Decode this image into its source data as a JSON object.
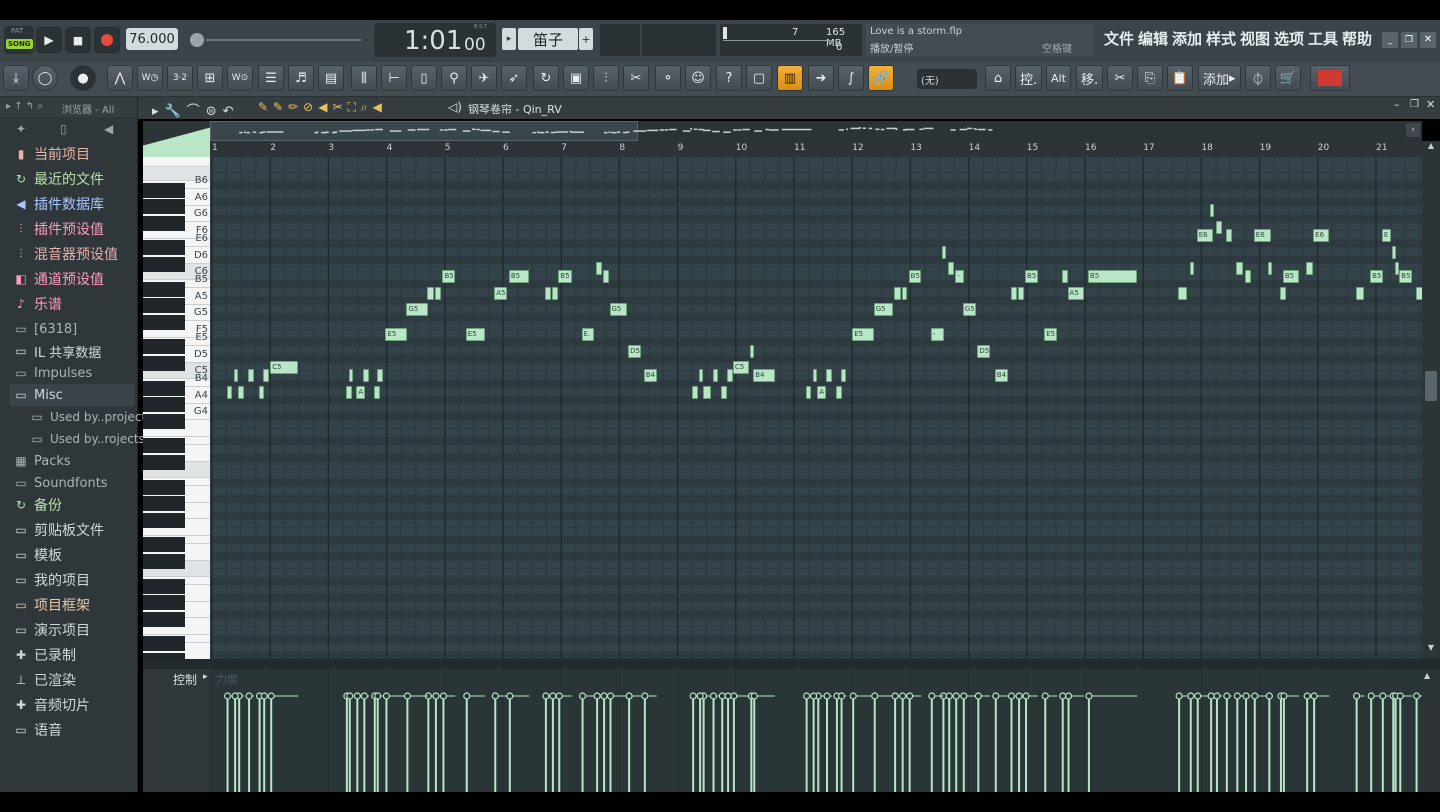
{
  "transport": {
    "pat_label": "PAT",
    "song_label": "SONG",
    "tempo": "76.000",
    "time_display": "1:01",
    "time_sub": "00",
    "bst": "B:S:T",
    "instrument": "笛子",
    "cpu_value": "7",
    "memory": "165 MB",
    "poly": "0"
  },
  "hint": {
    "filename": "Love is a storm.flp",
    "action": "播放/暂停",
    "key": "空格键"
  },
  "menu": [
    "文件",
    "编辑",
    "添加",
    "样式",
    "视图",
    "选项",
    "工具",
    "帮助"
  ],
  "toolbar": {
    "control_label": "控.",
    "alt_label": "Alt",
    "move_label": "移.",
    "add_label": "添加",
    "snap_value": "(无)"
  },
  "browser": {
    "title": "浏览器 - All",
    "items": [
      {
        "label": "当前项目",
        "icon": "project-icon",
        "color": "#e8b4a8"
      },
      {
        "label": "最近的文件",
        "icon": "recent-icon",
        "color": "#b8e0a8"
      },
      {
        "label": "插件数据库",
        "icon": "plugin-db-icon",
        "color": "#a8c8ff"
      },
      {
        "label": "插件预设值",
        "icon": "plugin-preset-icon",
        "color": "#ff9ac0"
      },
      {
        "label": "混音器预设值",
        "icon": "mixer-preset-icon",
        "color": "#e8b0b0"
      },
      {
        "label": "通道预设值",
        "icon": "channel-preset-icon",
        "color": "#ff9ac0"
      },
      {
        "label": "乐谱",
        "icon": "score-icon",
        "color": "#ff9ac0"
      },
      {
        "label": "[6318]",
        "icon": "folder-icon",
        "color": "#aab4b8"
      },
      {
        "label": "IL 共享数据",
        "icon": "folder-icon",
        "color": "#d0d8dc"
      },
      {
        "label": "Impulses",
        "icon": "folder-icon",
        "color": "#aab4b8"
      },
      {
        "label": "Misc",
        "icon": "folder-icon",
        "color": "#d0d8dc"
      },
      {
        "label": "Used by..projects",
        "icon": "folder-icon",
        "color": "#aab4b8"
      },
      {
        "label": "Used by..rojects",
        "icon": "folder-icon",
        "color": "#aab4b8"
      },
      {
        "label": "Packs",
        "icon": "packs-icon",
        "color": "#aab4b8"
      },
      {
        "label": "Soundfonts",
        "icon": "folder-icon",
        "color": "#aab4b8"
      },
      {
        "label": "备份",
        "icon": "backup-icon",
        "color": "#b8e0a8"
      },
      {
        "label": "剪贴板文件",
        "icon": "folder-icon",
        "color": "#d0d8dc"
      },
      {
        "label": "模板",
        "icon": "folder-icon",
        "color": "#d0d8dc"
      },
      {
        "label": "我的项目",
        "icon": "folder-icon",
        "color": "#d0d8dc"
      },
      {
        "label": "项目框架",
        "icon": "folder-icon",
        "color": "#e8c8a8"
      },
      {
        "label": "演示项目",
        "icon": "folder-icon",
        "color": "#d0d8dc"
      },
      {
        "label": "已录制",
        "icon": "recorded-icon",
        "color": "#d0d8dc"
      },
      {
        "label": "已渲染",
        "icon": "rendered-icon",
        "color": "#d0d8dc"
      },
      {
        "label": "音频切片",
        "icon": "slice-icon",
        "color": "#d0d8dc"
      },
      {
        "label": "语音",
        "icon": "voice-icon",
        "color": "#d0d8dc"
      }
    ]
  },
  "pianoroll": {
    "title": "钢琴卷帘 - Qin_RV",
    "control_label": "控制",
    "lane_label": "力度",
    "bars": [
      "1",
      "2",
      "3",
      "4",
      "5",
      "6",
      "7",
      "8",
      "9",
      "10",
      "11",
      "12",
      "13",
      "14",
      "15",
      "16",
      "17",
      "18",
      "19",
      "20",
      "21"
    ],
    "key_labels": [
      "B6",
      "A6",
      "G6",
      "F6",
      "E6",
      "D6",
      "C6",
      "B5",
      "A5",
      "G5",
      "F5",
      "E5",
      "D5",
      "C5",
      "B4",
      "A4",
      "G4"
    ],
    "notes": [
      {
        "pitch": "A4",
        "bar": 1.25,
        "len": 0.1,
        "label": ""
      },
      {
        "pitch": "A4",
        "bar": 1.45,
        "len": 0.1,
        "label": ""
      },
      {
        "pitch": "A4",
        "bar": 1.8,
        "len": 0.1,
        "label": ""
      },
      {
        "pitch": "B4",
        "bar": 1.38,
        "len": 0.06,
        "label": ""
      },
      {
        "pitch": "B4",
        "bar": 1.62,
        "len": 0.1,
        "label": ""
      },
      {
        "pitch": "B4",
        "bar": 1.88,
        "len": 0.1,
        "label": ""
      },
      {
        "pitch": "C5",
        "bar": 2.0,
        "len": 0.48,
        "label": "C5"
      },
      {
        "pitch": "A4",
        "bar": 3.3,
        "len": 0.1,
        "label": ""
      },
      {
        "pitch": "A4",
        "bar": 3.48,
        "len": 0.15,
        "label": "A"
      },
      {
        "pitch": "A4",
        "bar": 3.78,
        "len": 0.1,
        "label": ""
      },
      {
        "pitch": "B4",
        "bar": 3.35,
        "len": 0.06,
        "label": ""
      },
      {
        "pitch": "B4",
        "bar": 3.6,
        "len": 0.1,
        "label": ""
      },
      {
        "pitch": "B4",
        "bar": 3.83,
        "len": 0.1,
        "label": ""
      },
      {
        "pitch": "E5",
        "bar": 3.98,
        "len": 0.37,
        "label": "E5"
      },
      {
        "pitch": "A5",
        "bar": 4.7,
        "len": 0.12,
        "label": ""
      },
      {
        "pitch": "A5",
        "bar": 4.83,
        "len": 0.1,
        "label": ""
      },
      {
        "pitch": "B5",
        "bar": 4.96,
        "len": 0.22,
        "label": "B5"
      },
      {
        "pitch": "G5",
        "bar": 4.34,
        "len": 0.37,
        "label": "G5"
      },
      {
        "pitch": "E5",
        "bar": 5.36,
        "len": 0.33,
        "label": "E5"
      },
      {
        "pitch": "A5",
        "bar": 5.85,
        "len": 0.22,
        "label": "A5"
      },
      {
        "pitch": "B5",
        "bar": 6.1,
        "len": 0.35,
        "label": "B5"
      },
      {
        "pitch": "A5",
        "bar": 6.72,
        "len": 0.1,
        "label": ""
      },
      {
        "pitch": "A5",
        "bar": 6.84,
        "len": 0.1,
        "label": ""
      },
      {
        "pitch": "B5",
        "bar": 6.95,
        "len": 0.23,
        "label": "B5"
      },
      {
        "pitch": "E5",
        "bar": 7.35,
        "len": 0.22,
        "label": "E."
      },
      {
        "pitch": "C6",
        "bar": 7.6,
        "len": 0.1,
        "label": ""
      },
      {
        "pitch": "B5",
        "bar": 7.72,
        "len": 0.1,
        "label": ""
      },
      {
        "pitch": "G5",
        "bar": 7.83,
        "len": 0.3,
        "label": "G5"
      },
      {
        "pitch": "D5",
        "bar": 8.15,
        "len": 0.22,
        "label": "D5"
      },
      {
        "pitch": "B4",
        "bar": 8.42,
        "len": 0.22,
        "label": "B4"
      },
      {
        "pitch": "A4",
        "bar": 9.25,
        "len": 0.1,
        "label": ""
      },
      {
        "pitch": "A4",
        "bar": 9.43,
        "len": 0.15,
        "label": ""
      },
      {
        "pitch": "A4",
        "bar": 9.75,
        "len": 0.1,
        "label": ""
      },
      {
        "pitch": "B4",
        "bar": 9.37,
        "len": 0.06,
        "label": ""
      },
      {
        "pitch": "B4",
        "bar": 9.6,
        "len": 0.1,
        "label": ""
      },
      {
        "pitch": "B4",
        "bar": 9.85,
        "len": 0.1,
        "label": ""
      },
      {
        "pitch": "C5",
        "bar": 9.95,
        "len": 0.28,
        "label": "C5"
      },
      {
        "pitch": "D5",
        "bar": 10.25,
        "len": 0.06,
        "label": ""
      },
      {
        "pitch": "B4",
        "bar": 10.3,
        "len": 0.37,
        "label": "B4"
      },
      {
        "pitch": "A4",
        "bar": 11.2,
        "len": 0.1,
        "label": ""
      },
      {
        "pitch": "A4",
        "bar": 11.4,
        "len": 0.15,
        "label": "A"
      },
      {
        "pitch": "A4",
        "bar": 11.72,
        "len": 0.1,
        "label": ""
      },
      {
        "pitch": "B4",
        "bar": 11.32,
        "len": 0.06,
        "label": ""
      },
      {
        "pitch": "B4",
        "bar": 11.55,
        "len": 0.1,
        "label": ""
      },
      {
        "pitch": "B4",
        "bar": 11.8,
        "len": 0.1,
        "label": ""
      },
      {
        "pitch": "E5",
        "bar": 12.0,
        "len": 0.37,
        "label": "E5"
      },
      {
        "pitch": "G5",
        "bar": 12.37,
        "len": 0.33,
        "label": "G5"
      },
      {
        "pitch": "A5",
        "bar": 12.72,
        "len": 0.12,
        "label": ""
      },
      {
        "pitch": "A5",
        "bar": 12.85,
        "len": 0.1,
        "label": ""
      },
      {
        "pitch": "B5",
        "bar": 12.97,
        "len": 0.22,
        "label": "B5"
      },
      {
        "pitch": "D6",
        "bar": 13.55,
        "len": 0.06,
        "label": ""
      },
      {
        "pitch": "C6",
        "bar": 13.65,
        "len": 0.1,
        "label": ""
      },
      {
        "pitch": "B5",
        "bar": 13.77,
        "len": 0.15,
        "label": "-"
      },
      {
        "pitch": "E5",
        "bar": 13.35,
        "len": 0.22,
        "label": "-"
      },
      {
        "pitch": "G5",
        "bar": 13.9,
        "len": 0.22,
        "label": "G5"
      },
      {
        "pitch": "D5",
        "bar": 14.15,
        "len": 0.22,
        "label": "D5"
      },
      {
        "pitch": "B4",
        "bar": 14.45,
        "len": 0.22,
        "label": "B4"
      },
      {
        "pitch": "A5",
        "bar": 14.72,
        "len": 0.12,
        "label": ""
      },
      {
        "pitch": "A5",
        "bar": 14.85,
        "len": 0.1,
        "label": ""
      },
      {
        "pitch": "B5",
        "bar": 14.97,
        "len": 0.22,
        "label": "B5"
      },
      {
        "pitch": "E5",
        "bar": 15.3,
        "len": 0.22,
        "label": "E5"
      },
      {
        "pitch": "B5",
        "bar": 15.6,
        "len": 0.1,
        "label": ""
      },
      {
        "pitch": "A5",
        "bar": 15.7,
        "len": 0.28,
        "label": "A5"
      },
      {
        "pitch": "B5",
        "bar": 16.05,
        "len": 0.85,
        "label": "B5"
      },
      {
        "pitch": "A5",
        "bar": 17.6,
        "len": 0.15,
        "label": ""
      },
      {
        "pitch": "C6",
        "bar": 17.8,
        "len": 0.06,
        "label": ""
      },
      {
        "pitch": "E6",
        "bar": 17.92,
        "len": 0.28,
        "label": "E6"
      },
      {
        "pitch": "G6",
        "bar": 18.15,
        "len": 0.06,
        "label": ""
      },
      {
        "pitch": "F6",
        "bar": 18.25,
        "len": 0.1,
        "label": ""
      },
      {
        "pitch": "E6",
        "bar": 18.42,
        "len": 0.1,
        "label": ""
      },
      {
        "pitch": "C6",
        "bar": 18.6,
        "len": 0.12,
        "label": ""
      },
      {
        "pitch": "B5",
        "bar": 18.75,
        "len": 0.1,
        "label": ""
      },
      {
        "pitch": "E6",
        "bar": 18.9,
        "len": 0.3,
        "label": "E6"
      },
      {
        "pitch": "C6",
        "bar": 19.15,
        "len": 0.06,
        "label": ""
      },
      {
        "pitch": "A5",
        "bar": 19.35,
        "len": 0.1,
        "label": ""
      },
      {
        "pitch": "B5",
        "bar": 19.4,
        "len": 0.28,
        "label": "B5"
      },
      {
        "pitch": "C6",
        "bar": 19.8,
        "len": 0.12,
        "label": ""
      },
      {
        "pitch": "E6",
        "bar": 19.92,
        "len": 0.28,
        "label": "E6"
      },
      {
        "pitch": "A5",
        "bar": 20.65,
        "len": 0.15,
        "label": ""
      },
      {
        "pitch": "B5",
        "bar": 20.9,
        "len": 0.22,
        "label": "B5"
      },
      {
        "pitch": "E6",
        "bar": 21.1,
        "len": 0.15,
        "label": "E"
      },
      {
        "pitch": "D6",
        "bar": 21.28,
        "len": 0.06,
        "label": ""
      },
      {
        "pitch": "C6",
        "bar": 21.32,
        "len": 0.06,
        "label": ""
      },
      {
        "pitch": "B5",
        "bar": 21.4,
        "len": 0.22,
        "label": "B5"
      },
      {
        "pitch": "A5",
        "bar": 21.68,
        "len": 0.12,
        "label": ""
      }
    ]
  },
  "colors": {
    "note": "#b9e6c6",
    "grid_bg": "#34434a",
    "accent": "#f3b03c",
    "record": "#e84a3c"
  }
}
